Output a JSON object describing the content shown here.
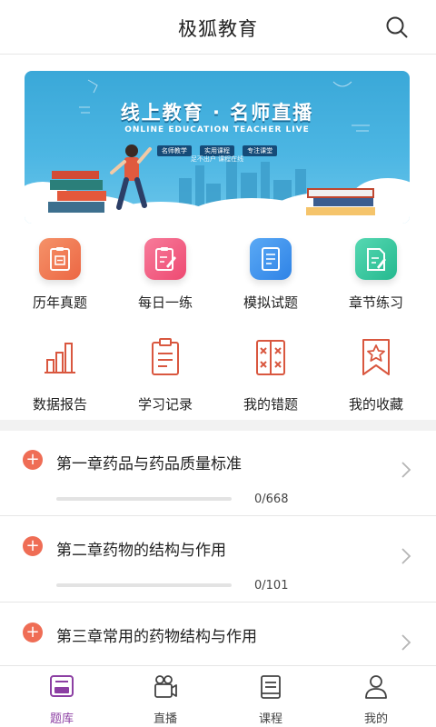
{
  "header": {
    "title": "极狐教育",
    "search_icon": "search-icon"
  },
  "banner": {
    "headline": "线上教育 · 名师直播",
    "subheadline": "ONLINE EDUCATION TEACHER LIVE",
    "tags": [
      "名师教学",
      "实用课程",
      "专注课堂"
    ],
    "footnote": "足不出户 课程在线",
    "colors": {
      "sky": "#4cb6e3",
      "cloud": "#ffffff"
    }
  },
  "quick_row_1": [
    {
      "label": "历年真题",
      "icon": "exam-paper-icon",
      "color": "#f07a54"
    },
    {
      "label": "每日一练",
      "icon": "daily-practice-icon",
      "color": "#f25d82"
    },
    {
      "label": "模拟试题",
      "icon": "mock-test-icon",
      "color": "#3d94ee"
    },
    {
      "label": "章节练习",
      "icon": "chapter-practice-icon",
      "color": "#38c9a1"
    }
  ],
  "quick_row_2": [
    {
      "label": "数据报告",
      "icon": "bar-chart-icon"
    },
    {
      "label": "学习记录",
      "icon": "clipboard-icon"
    },
    {
      "label": "我的错题",
      "icon": "wrong-questions-icon"
    },
    {
      "label": "我的收藏",
      "icon": "bookmark-star-icon"
    }
  ],
  "chapters": [
    {
      "title": "第一章药品与药品质量标准",
      "count": "0/668",
      "progress": 0
    },
    {
      "title": "第二章药物的结构与作用",
      "count": "0/101",
      "progress": 0
    },
    {
      "title": "第三章常用的药物结构与作用",
      "count": "",
      "progress": 0
    }
  ],
  "tabs": [
    {
      "label": "题库",
      "icon": "question-bank-icon",
      "active": true
    },
    {
      "label": "直播",
      "icon": "live-camera-icon",
      "active": false
    },
    {
      "label": "课程",
      "icon": "course-book-icon",
      "active": false
    },
    {
      "label": "我的",
      "icon": "profile-icon",
      "active": false
    }
  ],
  "colors": {
    "accent": "#ef6d55",
    "active_tab": "#8c3fa3",
    "line_icon": "#d9573f"
  }
}
